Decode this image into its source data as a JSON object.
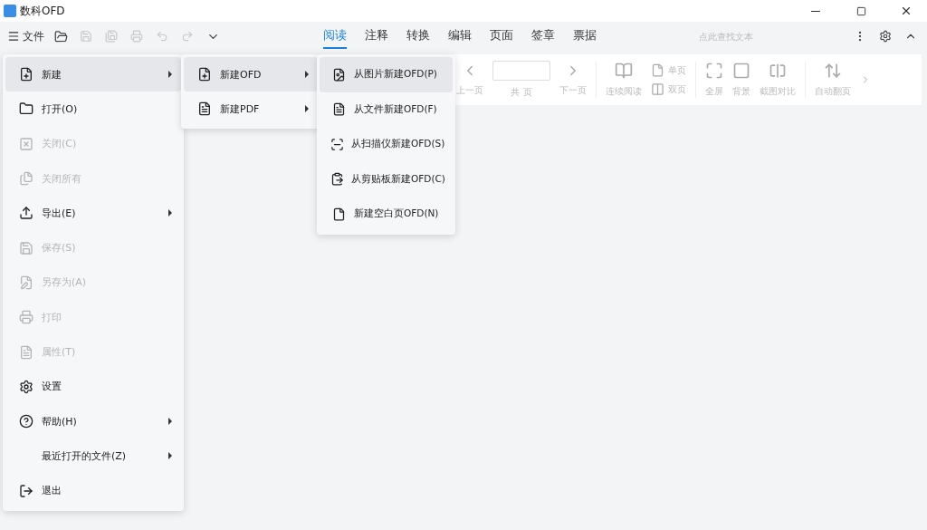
{
  "window": {
    "title": "数科OFD"
  },
  "toolbar": {
    "file_button": "文件",
    "search": {
      "placeholder": "点此查找文本"
    }
  },
  "tabs": [
    {
      "label": "阅读",
      "selected": true
    },
    {
      "label": "注释",
      "selected": false
    },
    {
      "label": "转换",
      "selected": false
    },
    {
      "label": "编辑",
      "selected": false
    },
    {
      "label": "页面",
      "selected": false
    },
    {
      "label": "签章",
      "selected": false
    },
    {
      "label": "票据",
      "selected": false
    }
  ],
  "ribbon": {
    "prev": "上一页",
    "page_total": "共 页",
    "next": "下一页",
    "continuous": "连续阅读",
    "single": "单页",
    "double": "双页",
    "fullscreen": "全屏",
    "background": "背景",
    "compare": "截图对比",
    "autoflip": "自动翻页"
  },
  "file_menu": [
    {
      "label": "新建",
      "disabled": false,
      "selected": true,
      "submenu": true
    },
    {
      "label": "打开(O)",
      "disabled": false,
      "selected": false,
      "submenu": false
    },
    {
      "label": "关闭(C)",
      "disabled": true,
      "selected": false,
      "submenu": false
    },
    {
      "label": "关闭所有",
      "disabled": true,
      "selected": false,
      "submenu": false
    },
    {
      "label": "导出(E)",
      "disabled": false,
      "selected": false,
      "submenu": true
    },
    {
      "label": "保存(S)",
      "disabled": true,
      "selected": false,
      "submenu": false
    },
    {
      "label": "另存为(A)",
      "disabled": true,
      "selected": false,
      "submenu": false
    },
    {
      "label": "打印",
      "disabled": true,
      "selected": false,
      "submenu": false
    },
    {
      "label": "属性(T)",
      "disabled": true,
      "selected": false,
      "submenu": false
    },
    {
      "label": "设置",
      "disabled": false,
      "selected": false,
      "submenu": false
    },
    {
      "label": "帮助(H)",
      "disabled": false,
      "selected": false,
      "submenu": true
    },
    {
      "label": "最近打开的文件(Z)",
      "disabled": false,
      "selected": false,
      "submenu": true
    },
    {
      "label": "退出",
      "disabled": false,
      "selected": false,
      "submenu": false
    }
  ],
  "new_menu": [
    {
      "label": "新建OFD",
      "selected": true,
      "submenu": true
    },
    {
      "label": "新建PDF",
      "selected": false,
      "submenu": true
    }
  ],
  "new_ofd_menu": [
    {
      "label": "从图片新建OFD(P)",
      "selected": true
    },
    {
      "label": "从文件新建OFD(F)",
      "selected": false
    },
    {
      "label": "从扫描仪新建OFD(S)",
      "selected": false
    },
    {
      "label": "从剪贴板新建OFD(C)",
      "selected": false
    },
    {
      "label": "新建空白页OFD(N)",
      "selected": false
    }
  ]
}
